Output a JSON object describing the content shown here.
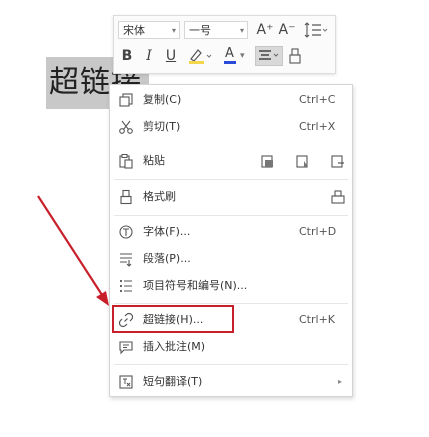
{
  "document": {
    "selected_text": "超链接"
  },
  "mini_toolbar": {
    "font_name": "宋体",
    "font_size": "一号",
    "grow_font_label": "A⁺",
    "shrink_font_label": "A⁻",
    "bold_label": "B",
    "italic_label": "I",
    "underline_label": "U",
    "font_color_label": "A",
    "dropdown_glyph": "▾"
  },
  "menu": {
    "items": [
      {
        "label": "复制(C)",
        "shortcut": "Ctrl+C"
      },
      {
        "label": "剪切(T)",
        "shortcut": "Ctrl+X"
      },
      {
        "label": "粘贴",
        "shortcut": ""
      },
      {
        "label": "格式刷",
        "shortcut": ""
      },
      {
        "label": "字体(F)...",
        "shortcut": "Ctrl+D"
      },
      {
        "label": "段落(P)...",
        "shortcut": ""
      },
      {
        "label": "项目符号和编号(N)...",
        "shortcut": ""
      },
      {
        "label": "超链接(H)...",
        "shortcut": "Ctrl+K"
      },
      {
        "label": "插入批注(M)",
        "shortcut": ""
      },
      {
        "label": "短句翻译(T)",
        "shortcut": "▸"
      }
    ]
  },
  "colors": {
    "annotation_red": "#c8202b",
    "highlight_yellow": "#f3d64b",
    "font_color_blue": "#2a4bd7"
  }
}
